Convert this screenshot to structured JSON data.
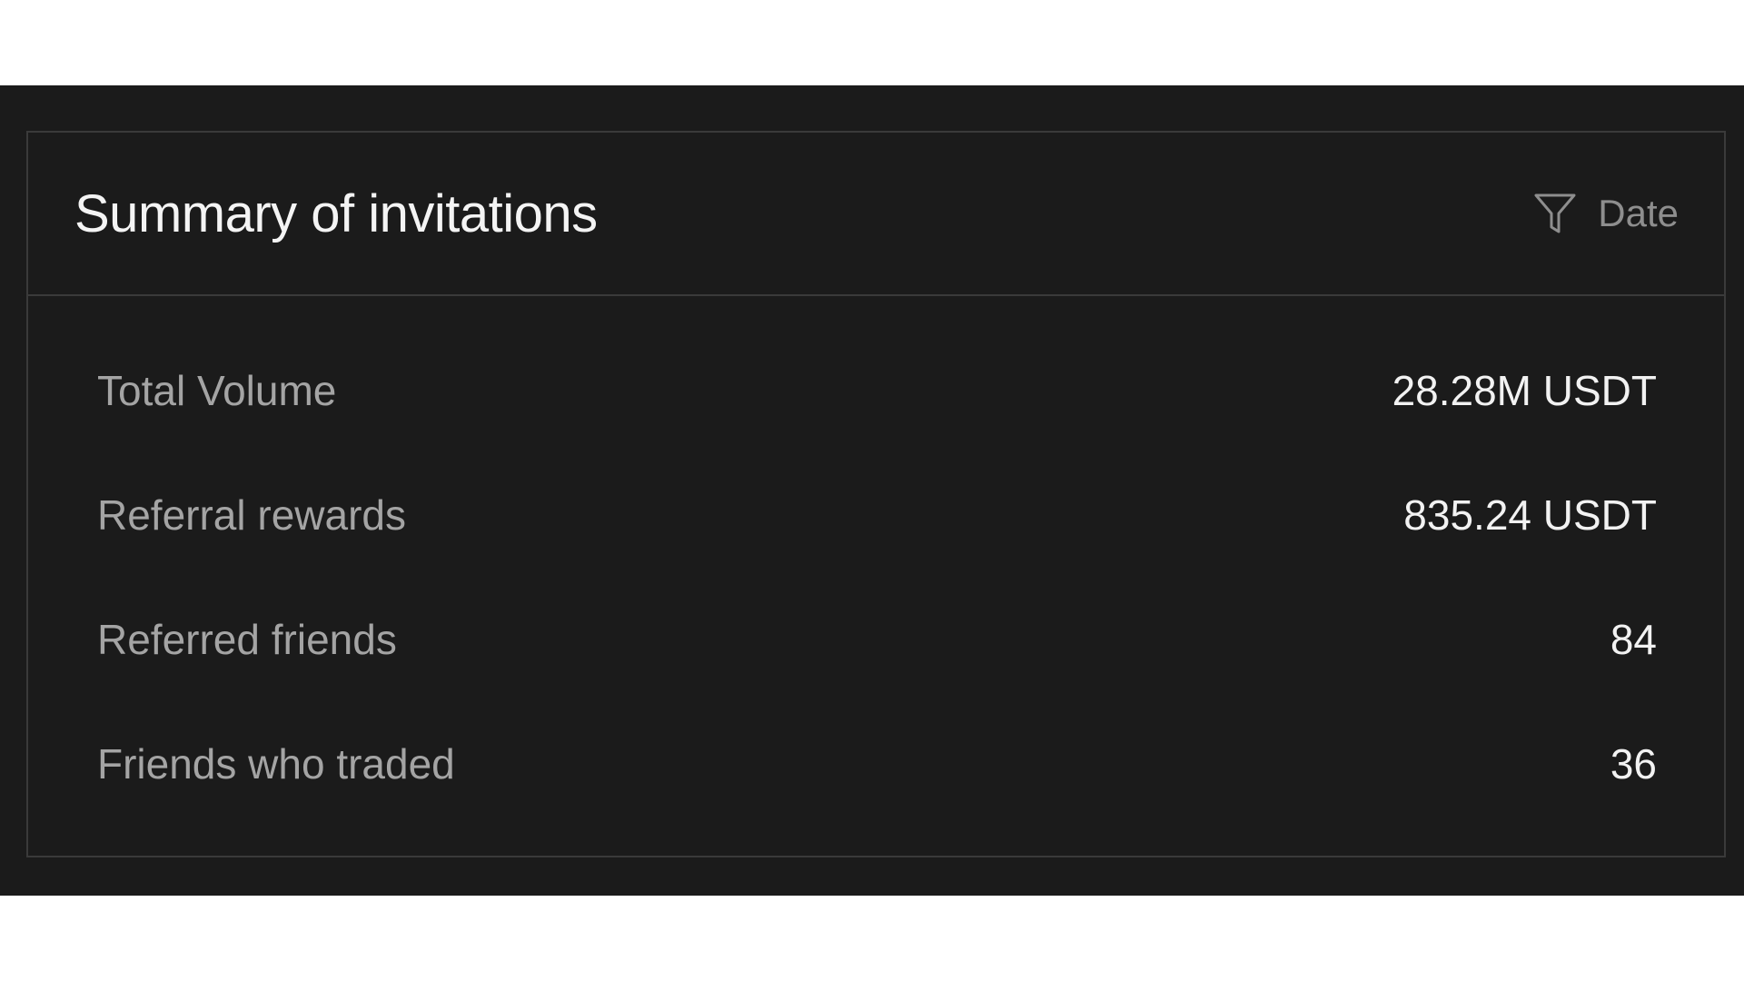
{
  "summary": {
    "title": "Summary of invitations",
    "filter": {
      "icon": "funnel-icon",
      "label": "Date"
    },
    "rows": [
      {
        "label": "Total Volume",
        "value": "28.28M USDT"
      },
      {
        "label": "Referral rewards",
        "value": "835.24 USDT"
      },
      {
        "label": "Referred friends",
        "value": "84"
      },
      {
        "label": "Friends who traded",
        "value": "36"
      }
    ]
  },
  "colors": {
    "background": "#1b1b1b",
    "border": "#3a3a3a",
    "title": "#f4f4f4",
    "label": "#a4a4a4",
    "value": "#f2f2f2",
    "filter": "#8e8e8e"
  }
}
